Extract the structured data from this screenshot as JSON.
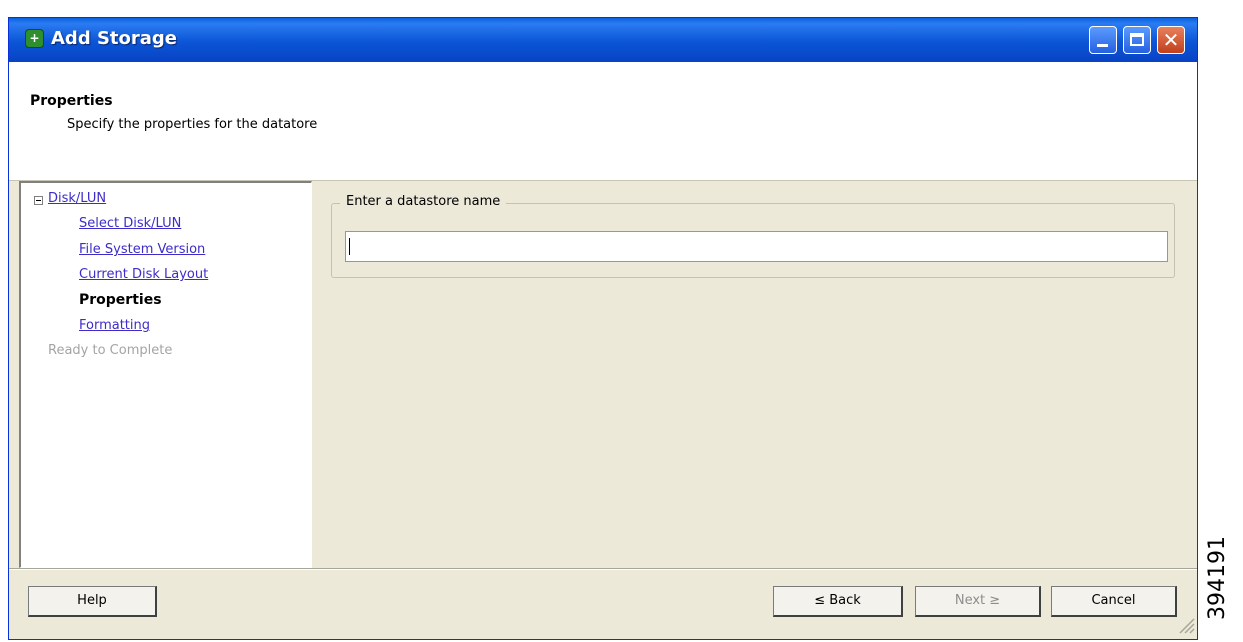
{
  "window": {
    "title": "Add Storage",
    "icon": "add-storage-icon",
    "controls": {
      "minimize": "minimize-icon",
      "maximize": "maximize-icon",
      "close": "close-icon",
      "close_glyph": "✕"
    }
  },
  "header": {
    "title": "Properties",
    "subtitle": "Specify the properties for the datatore"
  },
  "nav": {
    "group_label": "Disk/LUN",
    "items": [
      {
        "label": "Select Disk/LUN",
        "state": "link"
      },
      {
        "label": "File System Version",
        "state": "link"
      },
      {
        "label": "Current Disk Layout",
        "state": "link"
      },
      {
        "label": "Properties",
        "state": "current"
      },
      {
        "label": "Formatting",
        "state": "link"
      }
    ],
    "final_step": "Ready to Complete"
  },
  "form": {
    "group_label": "Enter a datastore name",
    "datastore_name_value": ""
  },
  "buttons": {
    "help": "Help",
    "back": "≤ Back",
    "next": "Next ≥",
    "cancel": "Cancel"
  },
  "figure_number": "394191",
  "colors": {
    "titlebar": "#0b55d6",
    "link": "#3d2cc8",
    "disabled": "#a4a4a4",
    "dialog_bg": "#ece9d8"
  }
}
